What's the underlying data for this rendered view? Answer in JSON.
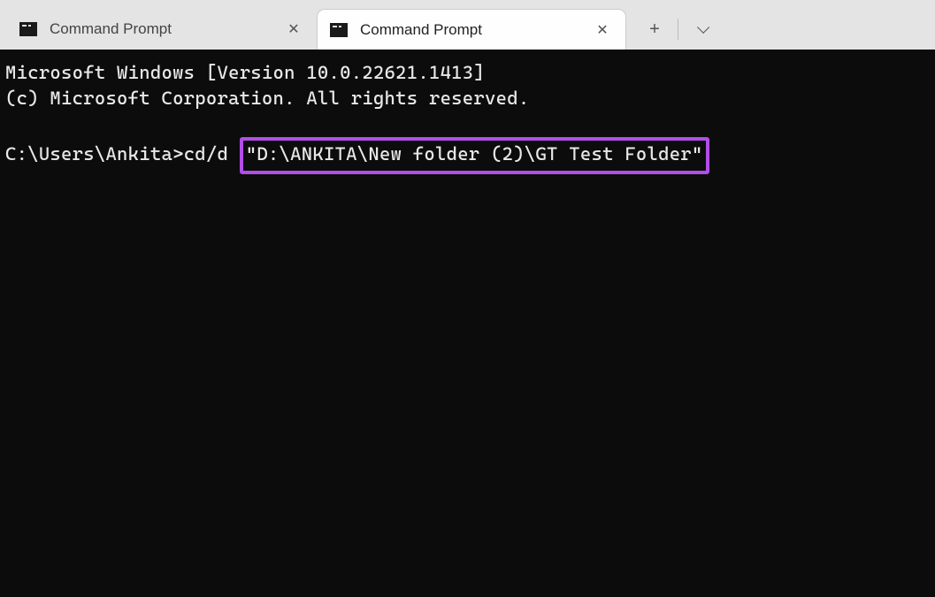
{
  "tabs": [
    {
      "title": "Command Prompt"
    },
    {
      "title": "Command Prompt"
    }
  ],
  "terminal": {
    "line1": "Microsoft Windows [Version 10.0.22621.1413]",
    "line2": "(c) Microsoft Corporation. All rights reserved.",
    "prompt": "C:\\Users\\Ankita>",
    "command_prefix": "cd/d ",
    "highlighted_path": "\"D:\\ANKITA\\New folder (2)\\GT Test Folder\""
  },
  "colors": {
    "highlight_border": "#b24ee8",
    "terminal_bg": "#0c0c0c",
    "terminal_fg": "#e8e8e8"
  }
}
